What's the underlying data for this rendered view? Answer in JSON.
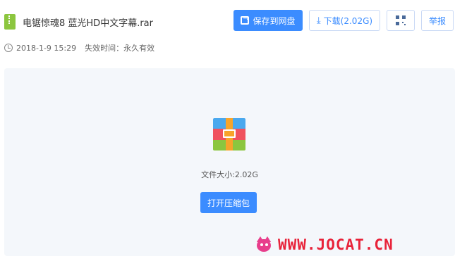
{
  "file": {
    "name": "电锯惊魂8 蓝光HD中文字幕.rar",
    "date": "2018-1-9 15:29",
    "expiry": "失效时间：永久有效"
  },
  "actions": {
    "save_label": "保存到网盘",
    "download_label": "下载(2.02G)",
    "report_label": "举报"
  },
  "preview": {
    "size_text": "文件大小:2.02G",
    "open_label": "打开压缩包"
  },
  "watermark": {
    "text": "WWW.JOCAT.CN"
  },
  "colors": {
    "primary": "#3b8cff",
    "watermark": "#e8233a"
  },
  "icons": [
    "rar-file-icon",
    "clock-icon",
    "save-to-cloud-icon",
    "download-icon",
    "qr-code-icon",
    "archive-icon",
    "cat-logo-icon"
  ]
}
